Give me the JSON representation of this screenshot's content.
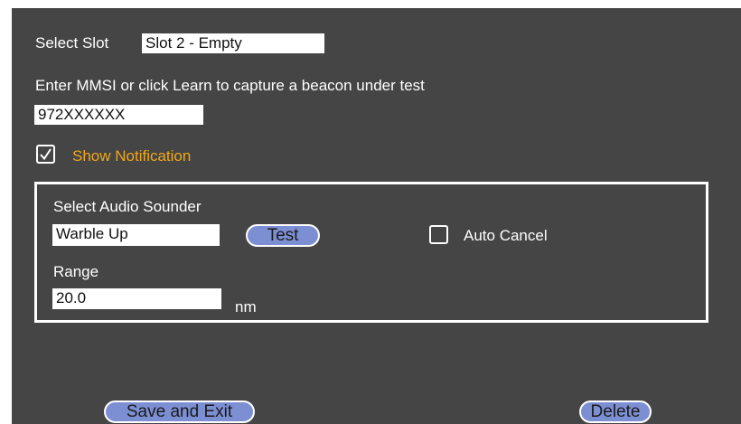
{
  "slot": {
    "label": "Select Slot",
    "value": "Slot 2 - Empty"
  },
  "mmsi": {
    "instruction": "Enter MMSI or click Learn to capture  a beacon under test",
    "value": "972XXXXXX"
  },
  "notification": {
    "label": "Show Notification",
    "checked": true,
    "color": "#f0a818"
  },
  "audio": {
    "label": "Select Audio Sounder",
    "value": "Warble Up",
    "test_label": "Test",
    "auto_cancel_label": "Auto Cancel",
    "auto_cancel_checked": false
  },
  "range": {
    "label": "Range",
    "value": "20.0",
    "unit": "nm"
  },
  "actions": {
    "save_label": "Save and Exit",
    "delete_label": "Delete"
  },
  "colors": {
    "background": "#454545",
    "button": "#7d8fd3",
    "accent": "#f0a818"
  }
}
